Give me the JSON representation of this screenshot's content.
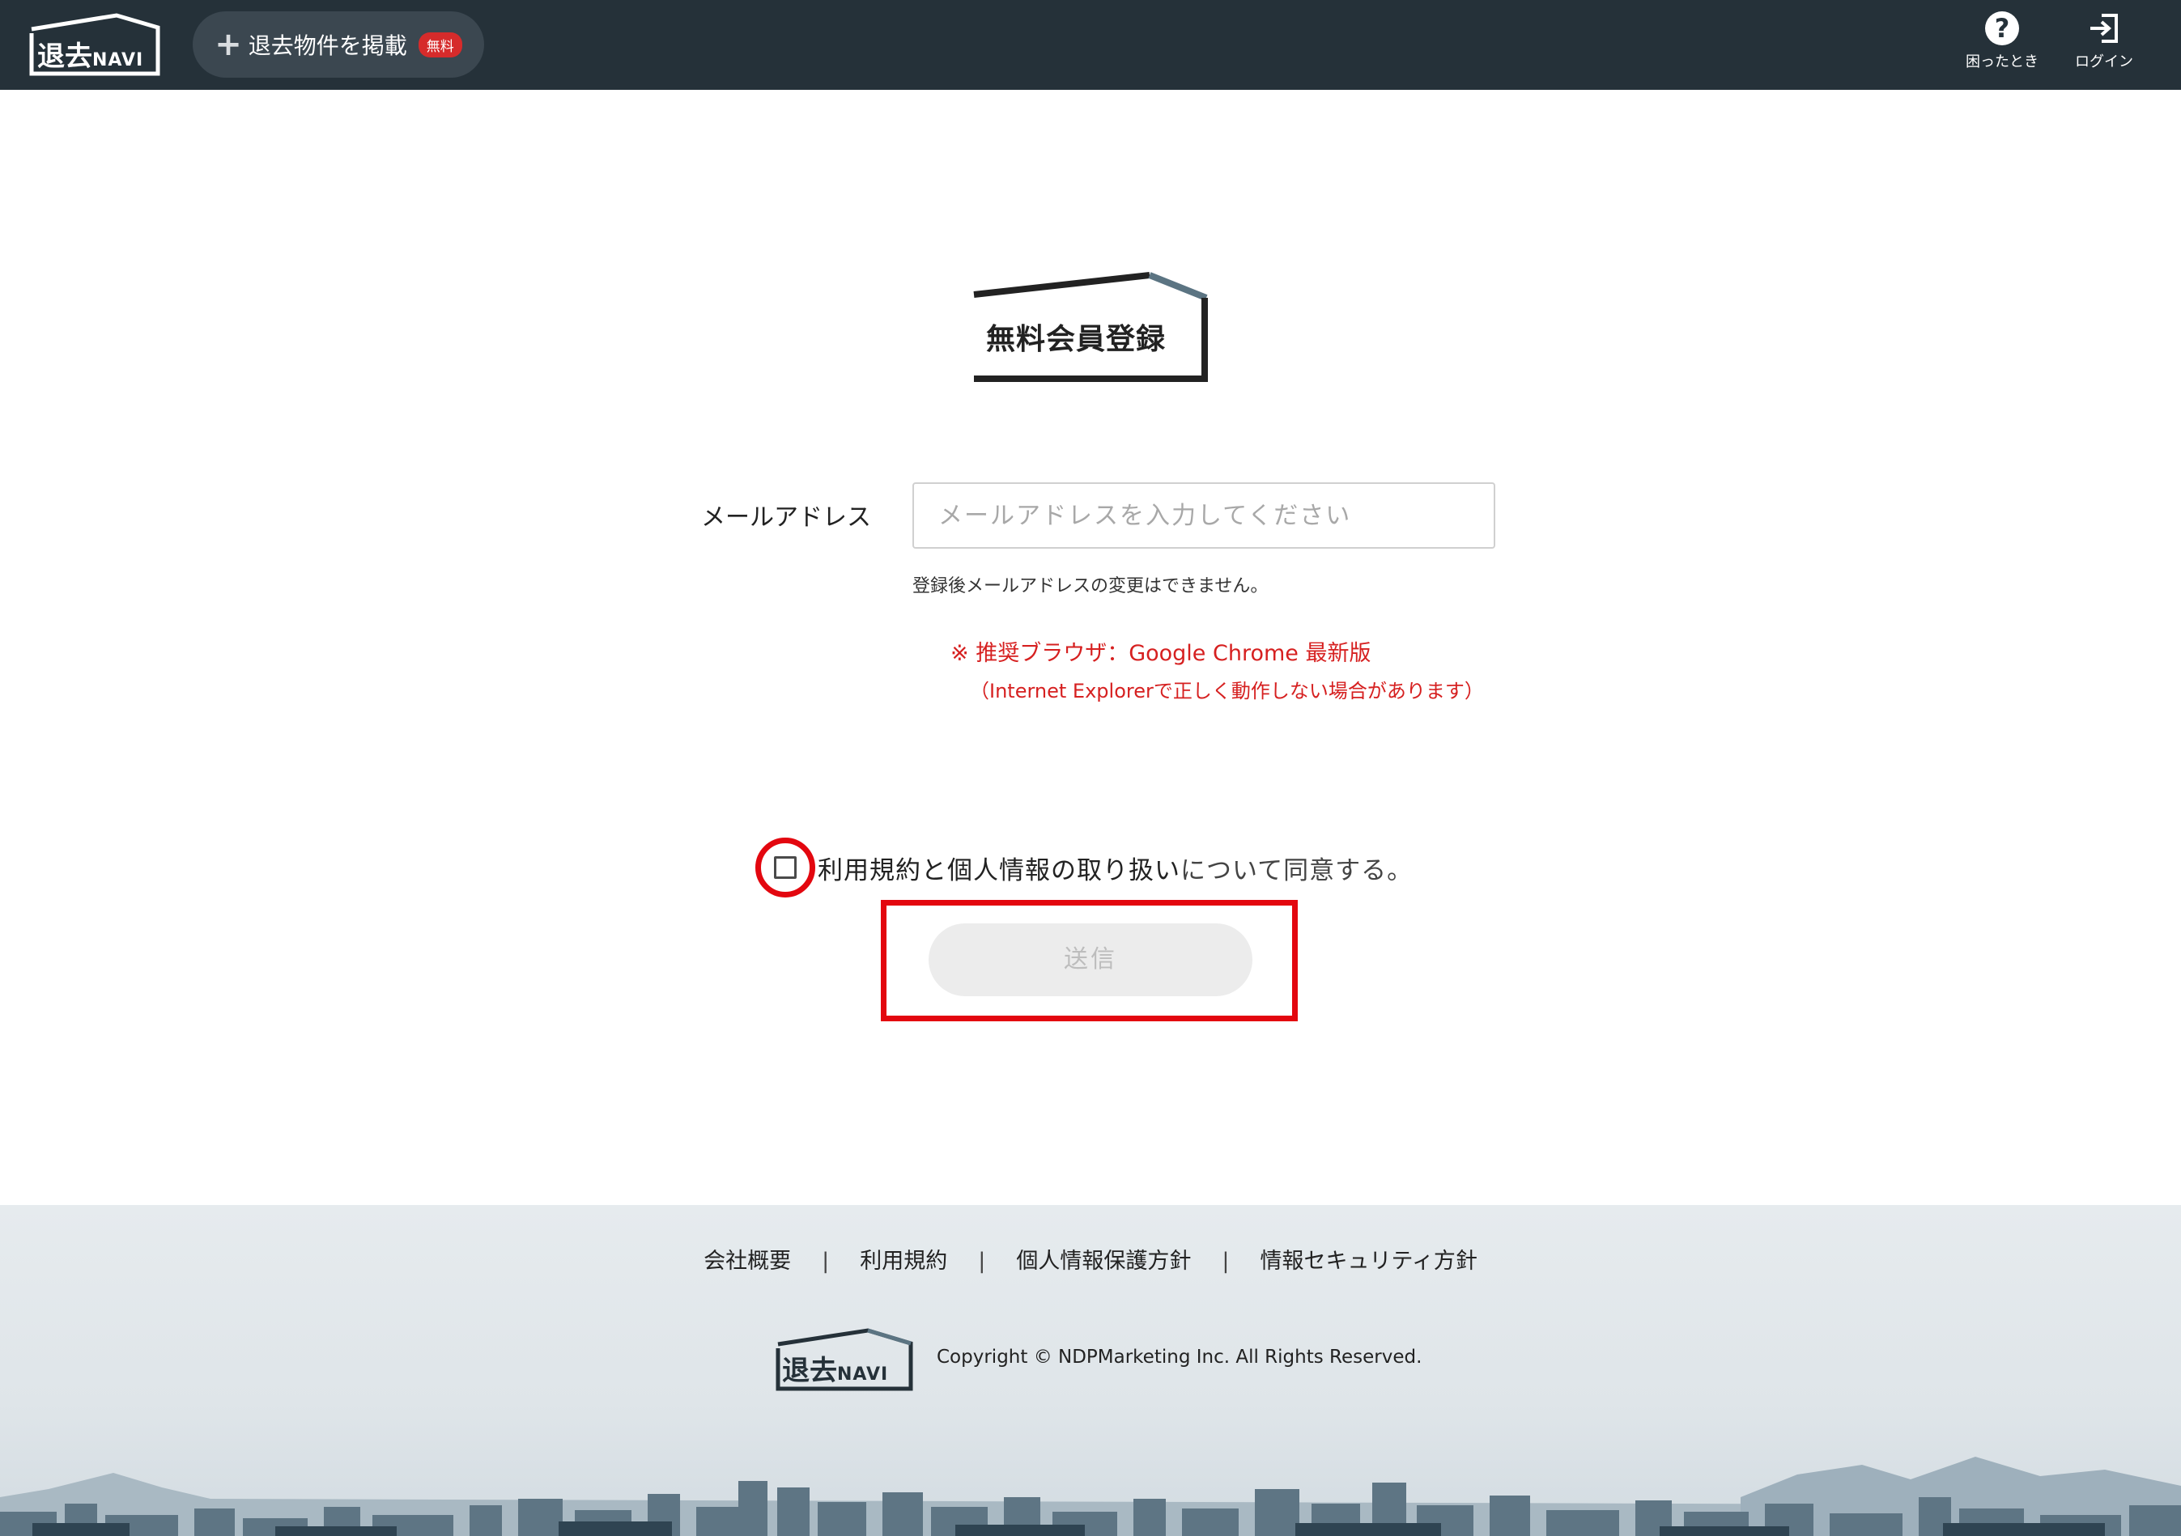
{
  "header": {
    "logo": {
      "main": "退去",
      "sub": "NAVI"
    },
    "post_button": {
      "label": "退去物件を掲載",
      "badge": "無料"
    },
    "help": {
      "label": "困ったとき"
    },
    "login": {
      "label": "ログイン"
    }
  },
  "main": {
    "title": "無料会員登録",
    "email": {
      "label": "メールアドレス",
      "placeholder": "メールアドレスを入力してください",
      "value": "",
      "note": "登録後メールアドレスの変更はできません。"
    },
    "recommendation": {
      "line1": "※ 推奨ブラウザ：Google Chrome 最新版",
      "line2": "（Internet Explorerで正しく動作しない場合があります）"
    },
    "agreement": {
      "checked": false,
      "link_text": "利用規約と個人情報の取り扱い",
      "rest_text": "について同意する。"
    },
    "submit": {
      "label": "送信",
      "disabled": true
    }
  },
  "footer": {
    "links": [
      "会社概要",
      "利用規約",
      "個人情報保護方針",
      "情報セキュリティ方針"
    ],
    "separator": "|",
    "logo": {
      "main": "退去",
      "sub": "NAVI"
    },
    "copyright": "Copyright © NDPMarketing Inc. All Rights Reserved."
  },
  "colors": {
    "header_bg": "#253139",
    "highlight_red": "#e3070f",
    "notice_red": "#d62020",
    "badge_red": "#d62b2b"
  },
  "icons": {
    "help": "question-circle-icon",
    "login": "login-arrow-icon",
    "add": "plus-icon"
  }
}
